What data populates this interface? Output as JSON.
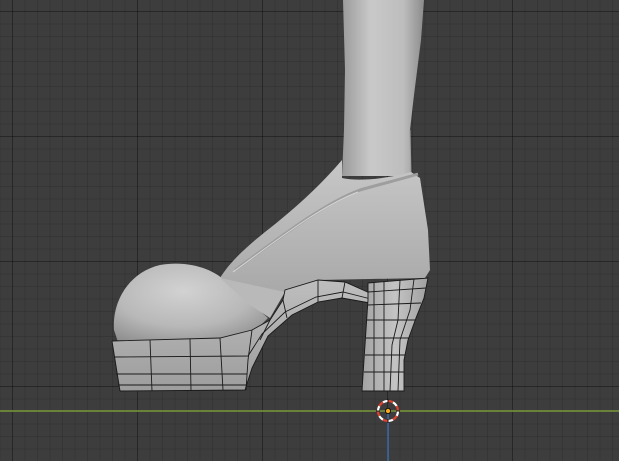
{
  "viewport": {
    "mode": "3d-viewport",
    "view": "front-orthographic"
  },
  "colors": {
    "background": "#3d3d3d",
    "grid_major": "#2e2e2e",
    "grid_minor": "#363636",
    "x_axis": "#7b9a3c",
    "z_axis": "#3d6fb0",
    "mesh_light": "#c8c8c8",
    "mesh_mid": "#a9a9a9",
    "mesh_dark": "#8f8f8f",
    "wireframe": "#1a1a1a",
    "cursor_red": "#e0422f",
    "cursor_white": "#ffffff",
    "origin_orange": "#f5a623"
  },
  "objects": [
    {
      "name": "leg",
      "type": "mesh"
    },
    {
      "name": "shoe",
      "type": "mesh"
    },
    {
      "name": "platform-sole",
      "type": "mesh",
      "display": "wireframe-overlay"
    },
    {
      "name": "heel",
      "type": "mesh",
      "display": "wireframe-overlay"
    }
  ],
  "icons": {
    "cursor": "3d-cursor-icon",
    "origin": "object-origin-icon"
  }
}
